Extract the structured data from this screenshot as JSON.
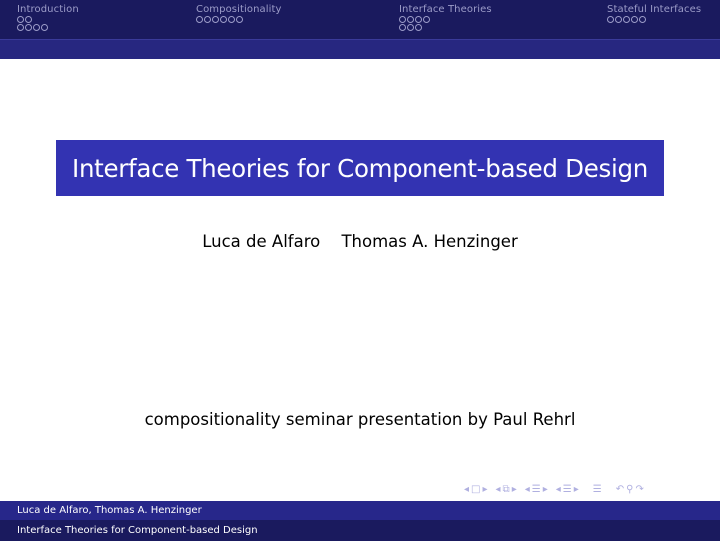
{
  "headline": {
    "sections": [
      {
        "name": "Introduction",
        "dot_rows": [
          2,
          4
        ]
      },
      {
        "name": "Compositionality",
        "dot_rows": [
          6
        ]
      },
      {
        "name": "Interface Theories",
        "dot_rows": [
          4,
          3
        ]
      },
      {
        "name": "Stateful Interfaces",
        "dot_rows": [
          5
        ]
      }
    ]
  },
  "title": "Interface Theories for Component-based Design",
  "authors": [
    "Luca de Alfaro",
    "Thomas A. Henzinger"
  ],
  "subtitle": "compositionality seminar presentation by Paul Rehrl",
  "nav": {
    "icons": [
      "frame-prev-icon",
      "frame-icon",
      "frame-next-icon",
      "subsection-prev-icon",
      "subsection-icon",
      "subsection-next-icon",
      "section-prev-icon",
      "section-icon",
      "section-next-icon",
      "appendix-icon",
      "back-icon",
      "search-icon",
      "forward-icon"
    ],
    "glyphs": [
      "◂",
      "□",
      "▸",
      "◂",
      "⧉",
      "▸",
      "◂",
      "☰",
      "▸",
      "◂",
      "☰",
      "▸",
      "☰",
      "↶",
      "⚲",
      "↷"
    ]
  },
  "footer": {
    "authors": "Luca de Alfaro, Thomas A. Henzinger",
    "title": "Interface Theories for Component-based Design"
  },
  "colors": {
    "headline_bg": "#1a1a5e",
    "subbar_bg": "#272780",
    "title_bg": "#3333b2",
    "footer_top_bg": "#27278a",
    "footer_bottom_bg": "#1a1a5e"
  }
}
